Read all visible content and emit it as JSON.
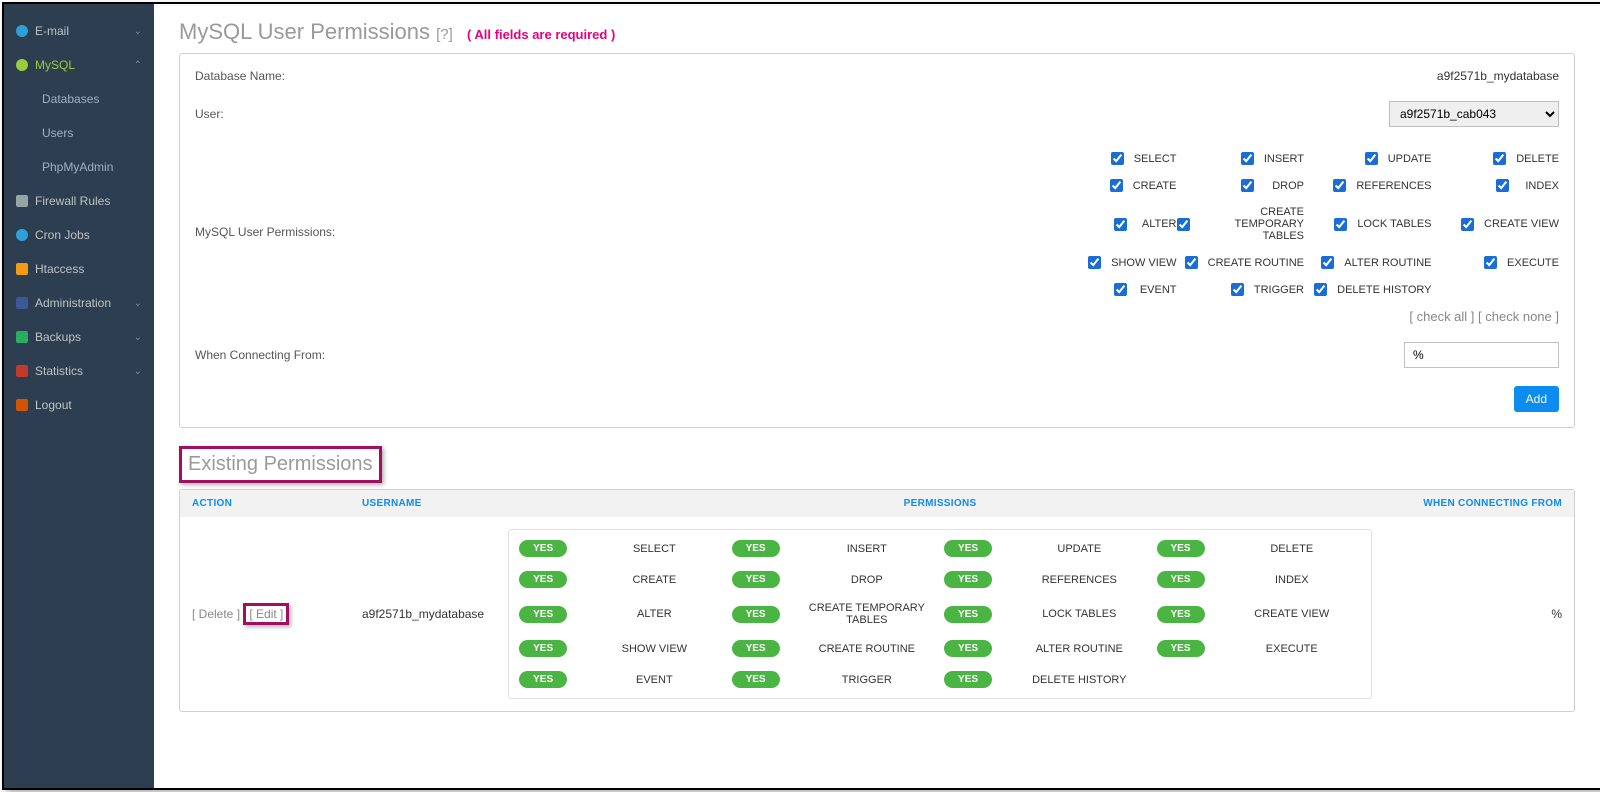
{
  "sidebar": {
    "items": [
      {
        "label": "E-mail",
        "icon": "email",
        "expand": true
      },
      {
        "label": "MySQL",
        "icon": "mysql",
        "active": true,
        "expand": true
      },
      {
        "label": "Databases",
        "sub": true
      },
      {
        "label": "Users",
        "sub": true
      },
      {
        "label": "PhpMyAdmin",
        "sub": true
      },
      {
        "label": "Firewall Rules",
        "icon": "firewall"
      },
      {
        "label": "Cron Jobs",
        "icon": "cron"
      },
      {
        "label": "Htaccess",
        "icon": "htaccess"
      },
      {
        "label": "Administration",
        "icon": "admin",
        "expand": true
      },
      {
        "label": "Backups",
        "icon": "backup",
        "expand": true
      },
      {
        "label": "Statistics",
        "icon": "stats",
        "expand": true
      },
      {
        "label": "Logout",
        "icon": "logout"
      }
    ]
  },
  "page": {
    "title": "MySQL User Permissions",
    "help": "[?]",
    "required_note": "( All fields are required )"
  },
  "form": {
    "db_label": "Database Name:",
    "db_value": "a9f2571b_mydatabase",
    "user_label": "User:",
    "user_value": "a9f2571b_cab043",
    "perm_label": "MySQL User Permissions:",
    "permissions": [
      [
        "SELECT",
        "INSERT",
        "UPDATE",
        "DELETE"
      ],
      [
        "CREATE",
        "DROP",
        "REFERENCES",
        "INDEX"
      ],
      [
        "ALTER",
        "CREATE TEMPORARY TABLES",
        "LOCK TABLES",
        "CREATE VIEW"
      ],
      [
        "SHOW VIEW",
        "CREATE ROUTINE",
        "ALTER ROUTINE",
        "EXECUTE"
      ],
      [
        "EVENT",
        "TRIGGER",
        "DELETE HISTORY",
        ""
      ]
    ],
    "check_all": "[ check all ]",
    "check_none": "[ check none ]",
    "conn_label": "When Connecting From:",
    "conn_value": "%",
    "add_btn": "Add"
  },
  "existing": {
    "title": "Existing Permissions",
    "headers": {
      "action": "ACTION",
      "username": "USERNAME",
      "permissions": "PERMISSIONS",
      "from": "WHEN CONNECTING FROM"
    },
    "row": {
      "delete": "[ Delete ]",
      "edit": "[ Edit ]",
      "username": "a9f2571b_mydatabase",
      "from": "%",
      "perms": [
        [
          "SELECT",
          "INSERT",
          "UPDATE",
          "DELETE"
        ],
        [
          "CREATE",
          "DROP",
          "REFERENCES",
          "INDEX"
        ],
        [
          "ALTER",
          "CREATE TEMPORARY TABLES",
          "LOCK TABLES",
          "CREATE VIEW"
        ],
        [
          "SHOW VIEW",
          "CREATE ROUTINE",
          "ALTER ROUTINE",
          "EXECUTE"
        ],
        [
          "EVENT",
          "TRIGGER",
          "DELETE HISTORY",
          ""
        ]
      ],
      "yes": "YES"
    }
  }
}
